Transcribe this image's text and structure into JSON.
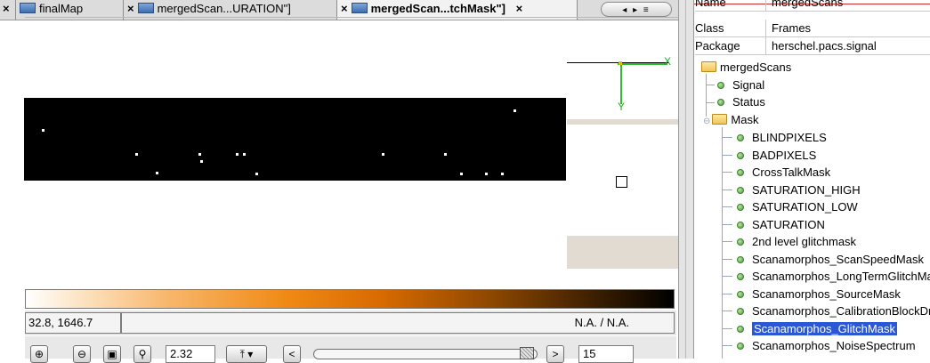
{
  "tabs": [
    {
      "label": "",
      "close": "×"
    },
    {
      "label": "finalMap",
      "close": "×"
    },
    {
      "label": "mergedScan...URATION\"]",
      "close": "×"
    },
    {
      "label": "mergedScan...tchMask\"]",
      "close": "×",
      "active": true
    }
  ],
  "tab_nav": "◂ ▸ ≡",
  "axes": {
    "x_label": "X",
    "y_label": "Y"
  },
  "status": {
    "coords": "32.8, 1646.7",
    "value": "N.A. / N.A."
  },
  "toolbar": {
    "zoom": "2.32",
    "prev": "<",
    "next": ">",
    "slice": "15"
  },
  "properties": [
    {
      "key": "Name",
      "value": "mergedScans"
    },
    {
      "key": "Class",
      "value": "Frames"
    },
    {
      "key": "Package",
      "value": "herschel.pacs.signal"
    }
  ],
  "tree": {
    "root": "mergedScans",
    "children": [
      "Signal",
      "Status"
    ],
    "mask_folder": "Mask",
    "mask_items": [
      "BLINDPIXELS",
      "BADPIXELS",
      "CrossTalkMask",
      "SATURATION_HIGH",
      "SATURATION_LOW",
      "SATURATION",
      "2nd level glitchmask",
      "Scanamorphos_ScanSpeedMask",
      "Scanamorphos_LongTermGlitchMask",
      "Scanamorphos_SourceMask",
      "Scanamorphos_CalibrationBlockDrop",
      "Scanamorphos_GlitchMask",
      "Scanamorphos_NoiseSpectrum"
    ],
    "selected": "Scanamorphos_GlitchMask"
  },
  "colors": {
    "selection": "#2a57d6",
    "axis": "#2cbf2c",
    "splitter_accent": "#cf2a2a"
  }
}
